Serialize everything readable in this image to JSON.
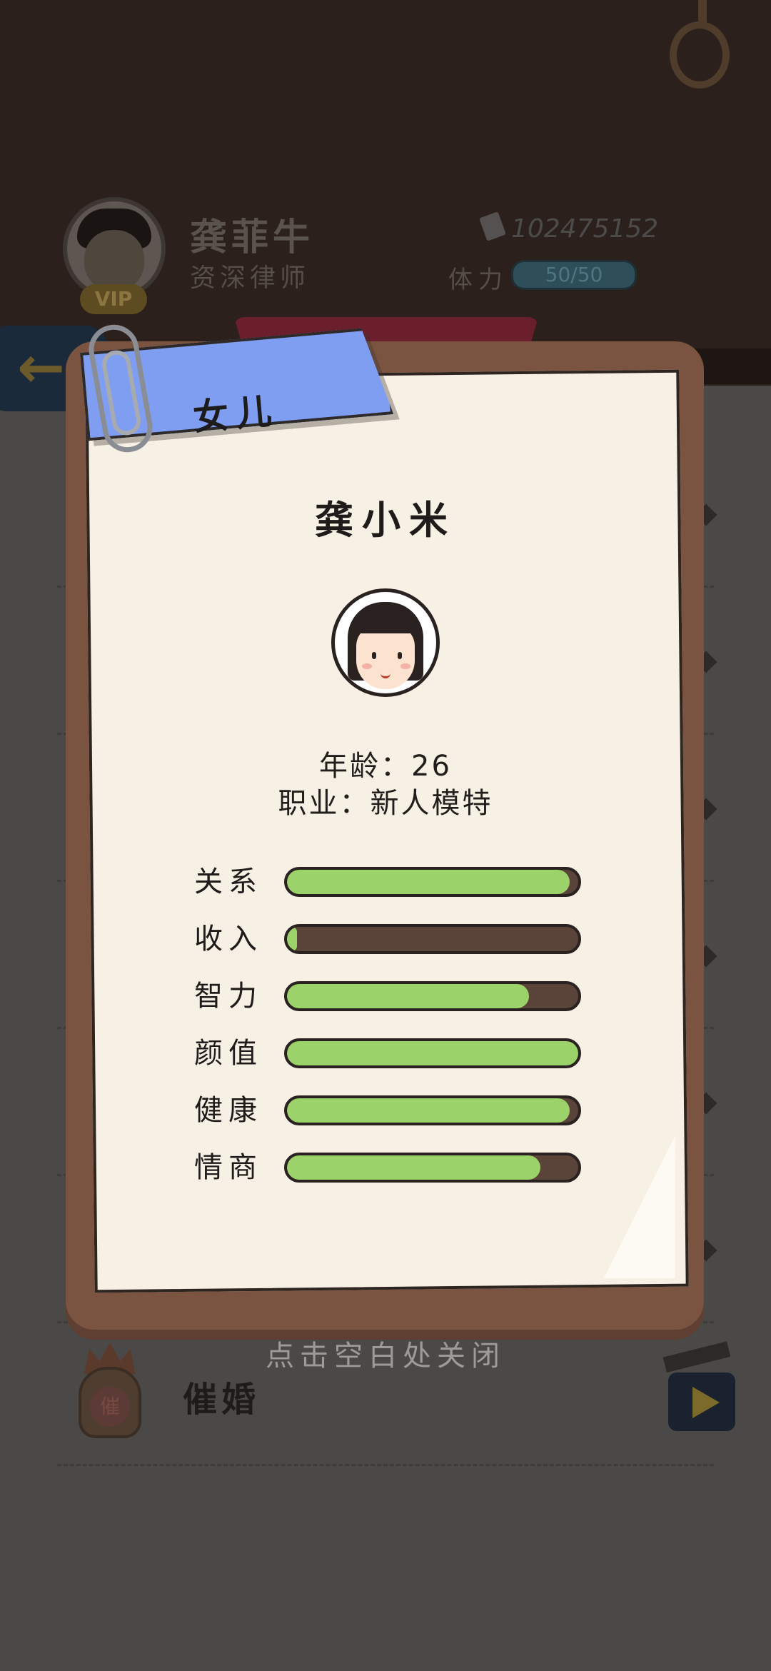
{
  "header": {
    "player_name": "龚菲牛",
    "player_title": "资深律师",
    "vip_label": "VIP",
    "money": "102475152",
    "stamina_label": "体力",
    "stamina_value": "50/50"
  },
  "list": {
    "urge_marriage_label": "催婚",
    "seal_char": "催"
  },
  "modal": {
    "ribbon_label": "女儿",
    "name": "龚小米",
    "age_line": "年龄：26",
    "job_line": "职业：新人模特",
    "stats": [
      {
        "label": "关系",
        "value": 0.97
      },
      {
        "label": "收入",
        "value": 0.03
      },
      {
        "label": "智力",
        "value": 0.83
      },
      {
        "label": "颜值",
        "value": 1.0
      },
      {
        "label": "健康",
        "value": 0.97
      },
      {
        "label": "情商",
        "value": 0.87
      }
    ],
    "close_hint": "点击空白处关闭"
  },
  "colors": {
    "ribbon": "#7f9ef2",
    "stat_fill": "#9bd26a",
    "folder": "#7a5441",
    "paper": "#f7f1e5"
  }
}
